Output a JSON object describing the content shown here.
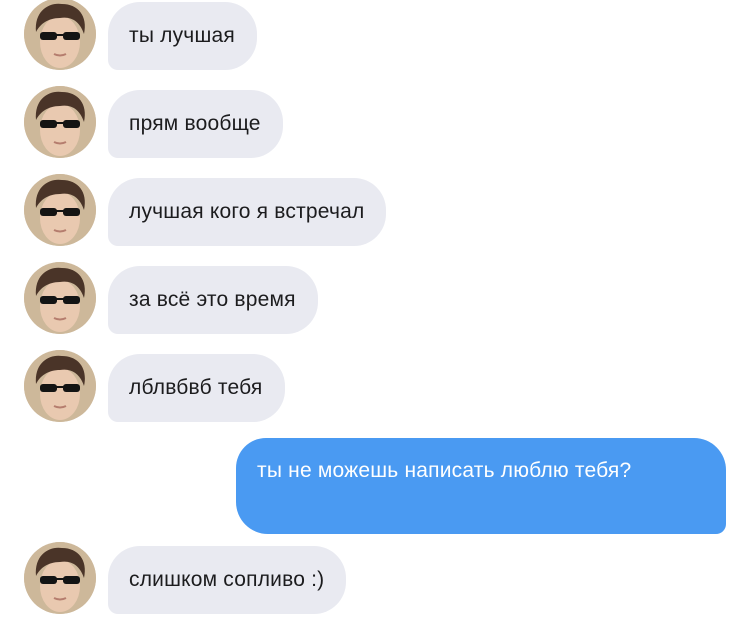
{
  "colors": {
    "incoming_bubble": "#e9eaf1",
    "outgoing_bubble": "#4a9af2",
    "incoming_text": "#1c1c1e",
    "outgoing_text": "#ffffff"
  },
  "messages": [
    {
      "direction": "incoming",
      "text": "ты лучшая",
      "avatar_icon": "avatar-photo"
    },
    {
      "direction": "incoming",
      "text": "прям вообще",
      "avatar_icon": "avatar-photo"
    },
    {
      "direction": "incoming",
      "text": "лучшая кого я встречал",
      "avatar_icon": "avatar-photo"
    },
    {
      "direction": "incoming",
      "text": "за всё это время",
      "avatar_icon": "avatar-photo"
    },
    {
      "direction": "incoming",
      "text": "лблвбвб тебя",
      "avatar_icon": "avatar-photo"
    },
    {
      "direction": "outgoing",
      "text": "ты не можешь написать люблю тебя?"
    },
    {
      "direction": "incoming",
      "text": "слишком сопливо :)",
      "avatar_icon": "avatar-photo"
    }
  ]
}
